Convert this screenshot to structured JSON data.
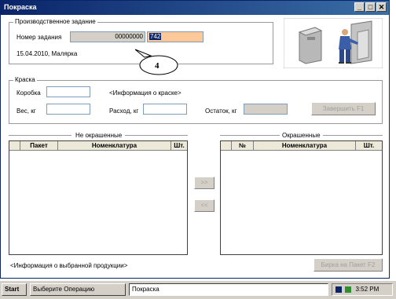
{
  "window": {
    "title": "Покраска",
    "min_glyph": "_",
    "max_glyph": "□",
    "close_glyph": "✕"
  },
  "task_group": {
    "label": "Производственное задание",
    "number_label": "Номер задания",
    "number_value": "00000000",
    "number_input": "742",
    "info": "15.04.2010, Малярка",
    "callout_number": "4"
  },
  "paint_group": {
    "label": "Краска",
    "box_label": "Коробка",
    "paint_info": "<Информация о краске>",
    "weight_label": "Вес, кг",
    "consumption_label": "Расход, кг",
    "remainder_label": "Остаток, кг",
    "finish_button": "Завершить    F1"
  },
  "unpainted": {
    "title": "Не окрашенные",
    "columns": [
      "Пакет",
      "Номенклатура",
      "Шт."
    ]
  },
  "painted": {
    "title": "Окрашенные",
    "columns": [
      "№",
      "Номенклатура",
      "Шт."
    ]
  },
  "move_right_button": ">>",
  "move_left_button": "<<",
  "product_info": "<Информация о выбранной продукции>",
  "tag_button": "Бирка на Пакет   F2",
  "taskbar": {
    "start": "Start",
    "item1": "Выберите Операцию",
    "item2": "Покраска",
    "clock": "3:52 PM"
  },
  "colors": {
    "title_bar": "#0a246a",
    "number_input_bg": "#ffc896",
    "selection_bg": "#0a246a"
  }
}
